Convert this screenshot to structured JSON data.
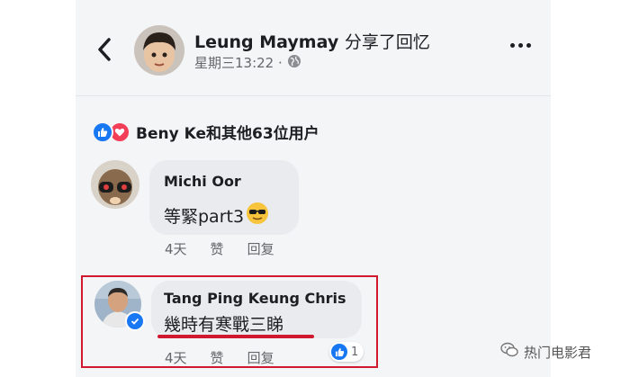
{
  "post": {
    "author": "Leung Maymay",
    "action": "分享了回忆",
    "timestamp": "星期三13:22 ·",
    "privacy_icon": "globe-icon"
  },
  "reactions": {
    "summary": "Beny Ke和其他63位用户"
  },
  "comments": [
    {
      "author": "Michi Oor",
      "text": "等緊part3",
      "emoji": "😎",
      "time": "4天",
      "like_label": "赞",
      "reply_label": "回复"
    },
    {
      "author": "Tang Ping Keung Chris",
      "text": "幾時有寒戰三睇",
      "time": "4天",
      "like_label": "赞",
      "reply_label": "回复",
      "like_count": "1",
      "verified": true
    }
  ],
  "watermark": {
    "text": "热门电影君"
  },
  "colors": {
    "highlight": "#d0182f",
    "like": "#1877f2",
    "love": "#f33e58",
    "bubble": "#e9ebee"
  }
}
